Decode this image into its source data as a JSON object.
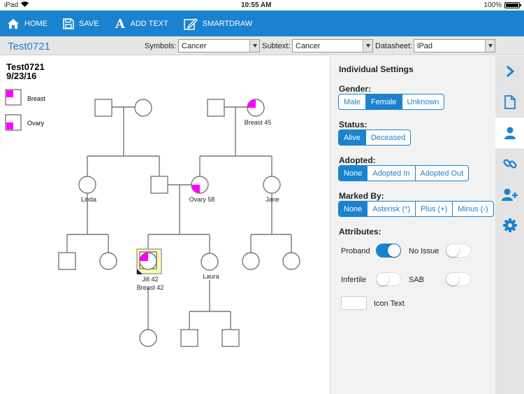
{
  "status_bar": {
    "device": "iPad",
    "time": "10:55 AM",
    "battery": "100%"
  },
  "toolbar": {
    "home_label": "HOME",
    "save_label": "SAVE",
    "add_text_label": "ADD TEXT",
    "smartdraw_label": "SMARTDRAW"
  },
  "header": {
    "doc_title": "Test0721",
    "symbols_label": "Symbols:",
    "symbols_value": "Cancer",
    "subtext_label": "Subtext:",
    "subtext_value": "Cancer",
    "datasheet_label": "Datasheet:",
    "datasheet_value": "iPad"
  },
  "pedigree": {
    "title": "Test0721",
    "date": "9/23/16",
    "legend": [
      "Breast",
      "Ovary"
    ],
    "labels": {
      "grandma_right": "Breast   45",
      "linda": "Linda",
      "ovary_mother": "Ovary   58",
      "jane": "Jane",
      "jill_name": "Jill   42",
      "jill_sub": "Breast   42",
      "laura": "Laura"
    },
    "colors": {
      "affected": "#ff00ff",
      "line": "#777777",
      "proband_fill": "#ffffb0"
    }
  },
  "settings": {
    "title": "Individual Settings",
    "gender_label": "Gender:",
    "gender_options": [
      "Male",
      "Female",
      "Unknown"
    ],
    "gender_selected": "Female",
    "status_label": "Status:",
    "status_options": [
      "Alive",
      "Deceased"
    ],
    "status_selected": "Alive",
    "adopted_label": "Adopted:",
    "adopted_options": [
      "None",
      "Adopted In",
      "Adopted Out"
    ],
    "adopted_selected": "None",
    "marked_label": "Marked By:",
    "marked_options": [
      "None",
      "Asterisk (*)",
      "Plus (+)",
      "Minus (-)"
    ],
    "marked_selected": "None",
    "attributes_label": "Attributes:",
    "proband_label": "Proband",
    "no_issue_label": "No Issue",
    "infertile_label": "Infertile",
    "sab_label": "SAB",
    "icon_text_label": "Icon Text"
  },
  "sidebar": {
    "icons": [
      "chevron-right-icon",
      "document-icon",
      "person-icon",
      "link-icon",
      "add-person-icon",
      "gear-icon"
    ],
    "active": "person-icon"
  },
  "theme": {
    "accent": "#1a82cf"
  }
}
